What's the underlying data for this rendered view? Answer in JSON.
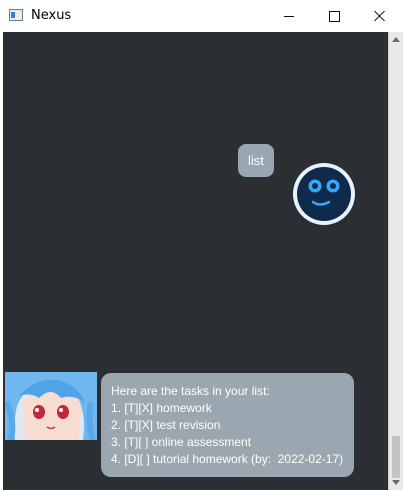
{
  "window": {
    "title": "Nexus"
  },
  "colors": {
    "chat_background": "#2b2e33",
    "bubble": "#9aa7b1",
    "bubble_text": "#ffffff",
    "robot_dark": "#0f2a4a",
    "robot_light": "#e7f1ff",
    "robot_eye": "#35a7ff"
  },
  "icons": {
    "app": "window-app-icon",
    "minimize": "minimize-icon",
    "maximize": "maximize-icon",
    "close": "close-icon",
    "bot": "robot-avatar-icon",
    "user": "anime-girl-avatar-icon"
  },
  "chat": {
    "user_message": "list",
    "bot_reply_lines": [
      "Here are the tasks in your list:",
      "1. [T][X] homework",
      "2. [T][X] test revision",
      "3. [T][ ] online assessment",
      "4. [D][ ] tutorial homework (by:  2022-02-17)"
    ]
  }
}
